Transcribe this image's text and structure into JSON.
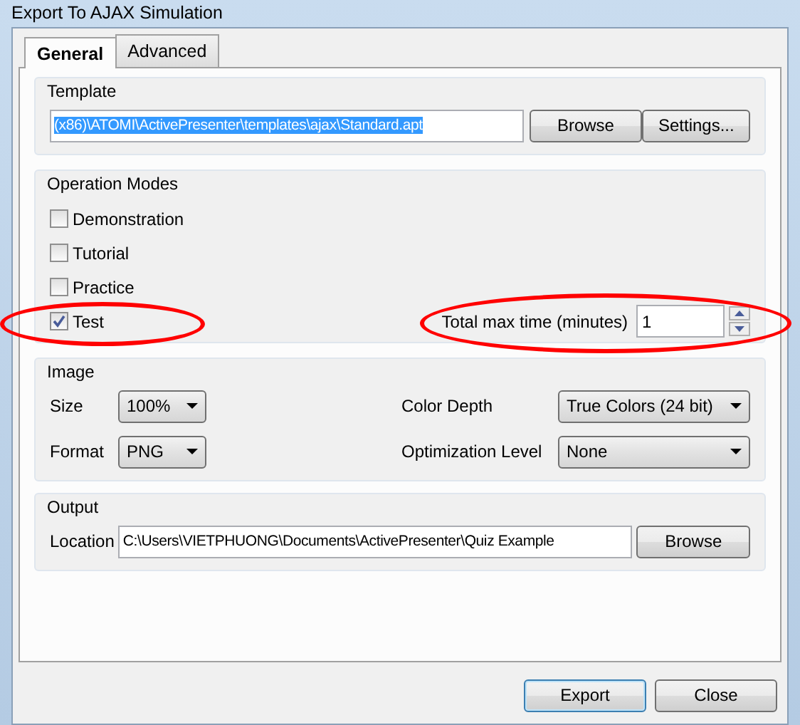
{
  "window": {
    "title": "Export To AJAX Simulation"
  },
  "tabs": [
    {
      "label": "General",
      "selected": true
    },
    {
      "label": "Advanced",
      "selected": false
    }
  ],
  "template": {
    "title": "Template",
    "path": "(x86)\\ATOMI\\ActivePresenter\\templates\\ajax\\Standard.apt",
    "text_selected": true,
    "buttons": [
      "Browse",
      "Settings..."
    ]
  },
  "operation_modes": {
    "title": "Operation Modes",
    "modes": [
      {
        "label": "Demonstration",
        "checked": false,
        "highlighted": false
      },
      {
        "label": "Tutorial",
        "checked": false,
        "highlighted": false
      },
      {
        "label": "Practice",
        "checked": false,
        "highlighted": false
      },
      {
        "label": "Test",
        "checked": true,
        "highlighted": true
      }
    ],
    "time_limit": {
      "label": "Total max time (minutes)",
      "value": "1",
      "highlighted": true
    }
  },
  "image": {
    "title": "Image",
    "fields": [
      {
        "label": "Size",
        "value": "100%"
      },
      {
        "label": "Color Depth",
        "value": "True Colors (24 bit)"
      },
      {
        "label": "Format",
        "value": "PNG"
      },
      {
        "label": "Optimization Level",
        "value": "None"
      }
    ]
  },
  "output": {
    "title": "Output",
    "label": "Location",
    "path": "C:\\Users\\VIETPHUONG\\Documents\\ActivePresenter\\Quiz Example",
    "button": "Browse"
  },
  "buttons": [
    {
      "label": "Export",
      "default": true
    },
    {
      "label": "Close",
      "default": false
    }
  ]
}
